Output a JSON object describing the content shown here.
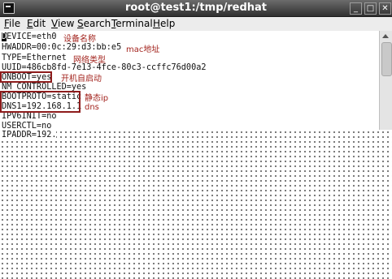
{
  "window": {
    "title": "root@test1:/tmp/redhat",
    "minimize": "_",
    "maximize": "□",
    "close": "✕"
  },
  "menu": [
    "File",
    "Edit",
    "View",
    "Search",
    "Terminal",
    "Help"
  ],
  "terminal": {
    "cursor_char": "D",
    "line1_rest": "EVICE=eth0",
    "lines": [
      "HWADDR=00:0c:29:d3:bb:e5",
      "TYPE=Ethernet",
      "UUID=486cb8fd-7e13-4fce-80c3-ccffc76d00a2",
      "ONBOOT=yes",
      "NM_CONTROLLED=yes",
      "BOOTPROTO=static",
      "DNS1=192.168.1.1",
      "IPV6INIT=no",
      "USERCTL=no",
      "IPADDR=192."
    ]
  },
  "annotations": {
    "device": "设备名称",
    "mac": "mac地址",
    "type": "网络类型",
    "onboot": "开机自启动",
    "static_ip": "静态ip",
    "dns": "dns"
  },
  "colors": {
    "annotation": "#a3241e",
    "highlight_box": "#8e1c1c"
  }
}
